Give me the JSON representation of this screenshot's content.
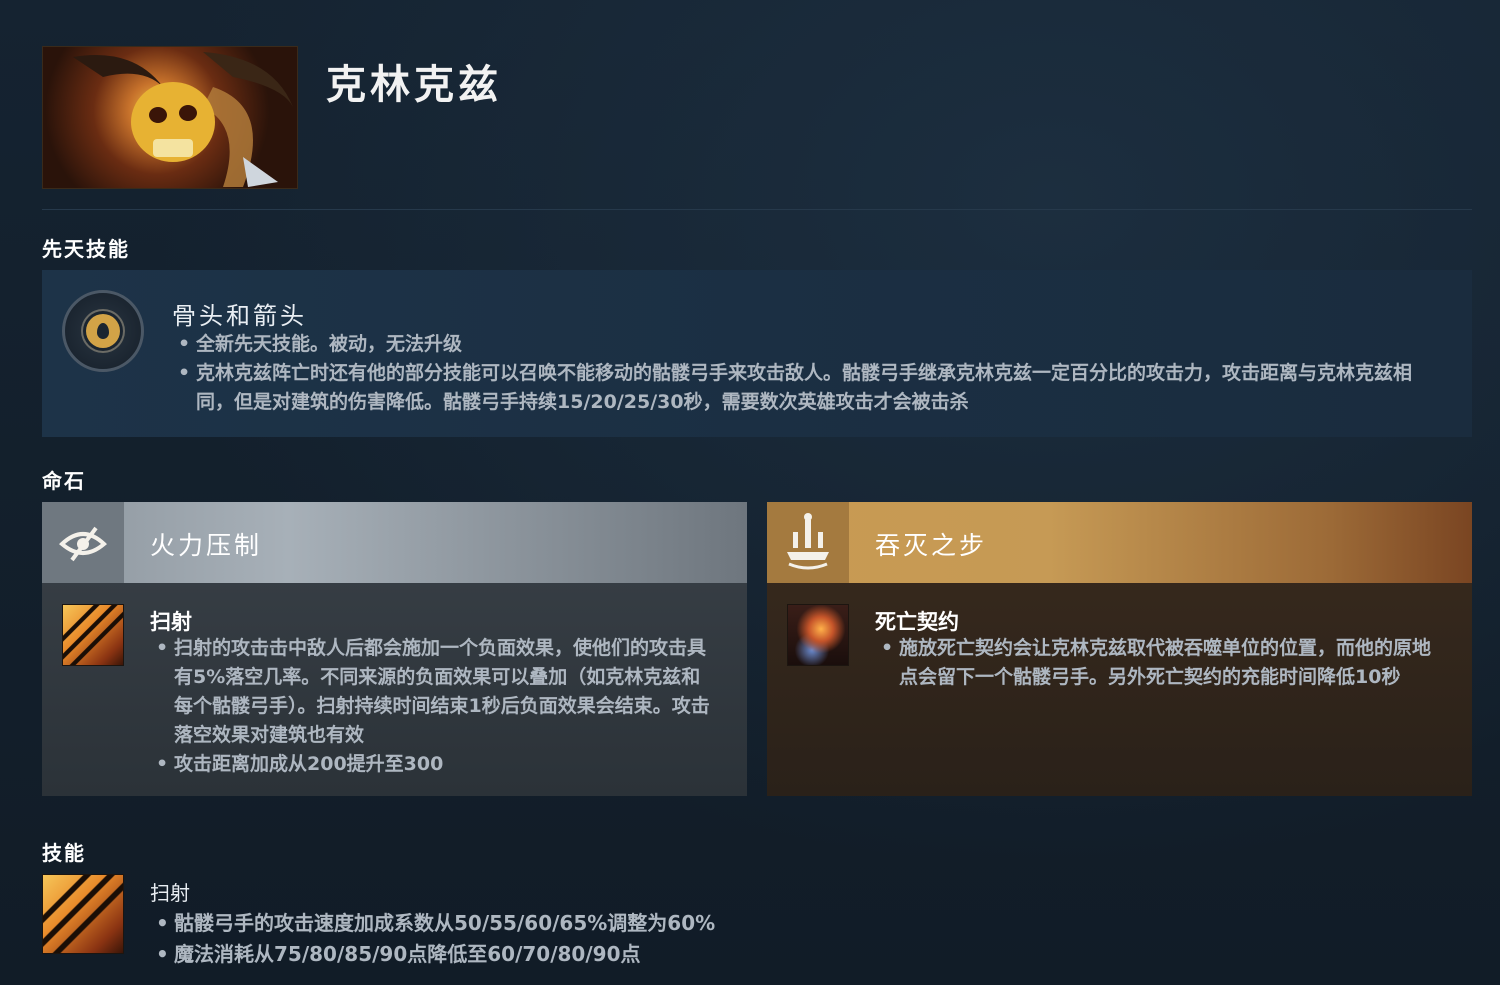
{
  "hero": {
    "name": "克林克兹",
    "portrait_icon": "clinkz-portrait"
  },
  "innate": {
    "section_title": "先天技能",
    "name": "骨头和箭头",
    "icon": "innate-ability-icon",
    "bullets": [
      "全新先天技能。被动，无法升级",
      "克林克兹阵亡时还有他的部分技能可以召唤不能移动的骷髅弓手来攻击敌人。骷髅弓手继承克林克兹一定百分比的攻击力，攻击距离与克林克兹相同，但是对建筑的伤害降低。骷髅弓手持续15/20/25/30秒，需要数次英雄攻击才会被击杀"
    ]
  },
  "facets": {
    "section_title": "命石",
    "items": [
      {
        "title": "火力压制",
        "icon": "suppressive-fire-icon",
        "glyph": "👁",
        "ability_name": "扫射",
        "ability_icon": "strafe-icon",
        "bullets": [
          "扫射的攻击击中敌人后都会施加一个负面效果，使他们的攻击具有5%落空几率。不同来源的负面效果可以叠加（如克林克兹和每个骷髅弓手）。扫射持续时间结束1秒后负面效果会结束。攻击落空效果对建筑也有效",
          "攻击距离加成从200提升至300"
        ],
        "color": "#a7b0b8"
      },
      {
        "title": "吞灭之步",
        "icon": "engulfing-step-icon",
        "glyph": "⚱",
        "ability_name": "死亡契约",
        "ability_icon": "death-pact-icon",
        "bullets": [
          "施放死亡契约会让克林克兹取代被吞噬单位的位置，而他的原地点会留下一个骷髅弓手。另外死亡契约的充能时间降低10秒"
        ],
        "color": "#c69a55"
      }
    ]
  },
  "skills": {
    "section_title": "技能",
    "items": [
      {
        "name": "扫射",
        "icon": "strafe-icon",
        "bullets": [
          "骷髅弓手的攻击速度加成系数从50/55/60/65%调整为60%",
          "魔法消耗从75/80/85/90点降低至60/70/80/90点"
        ]
      }
    ]
  }
}
